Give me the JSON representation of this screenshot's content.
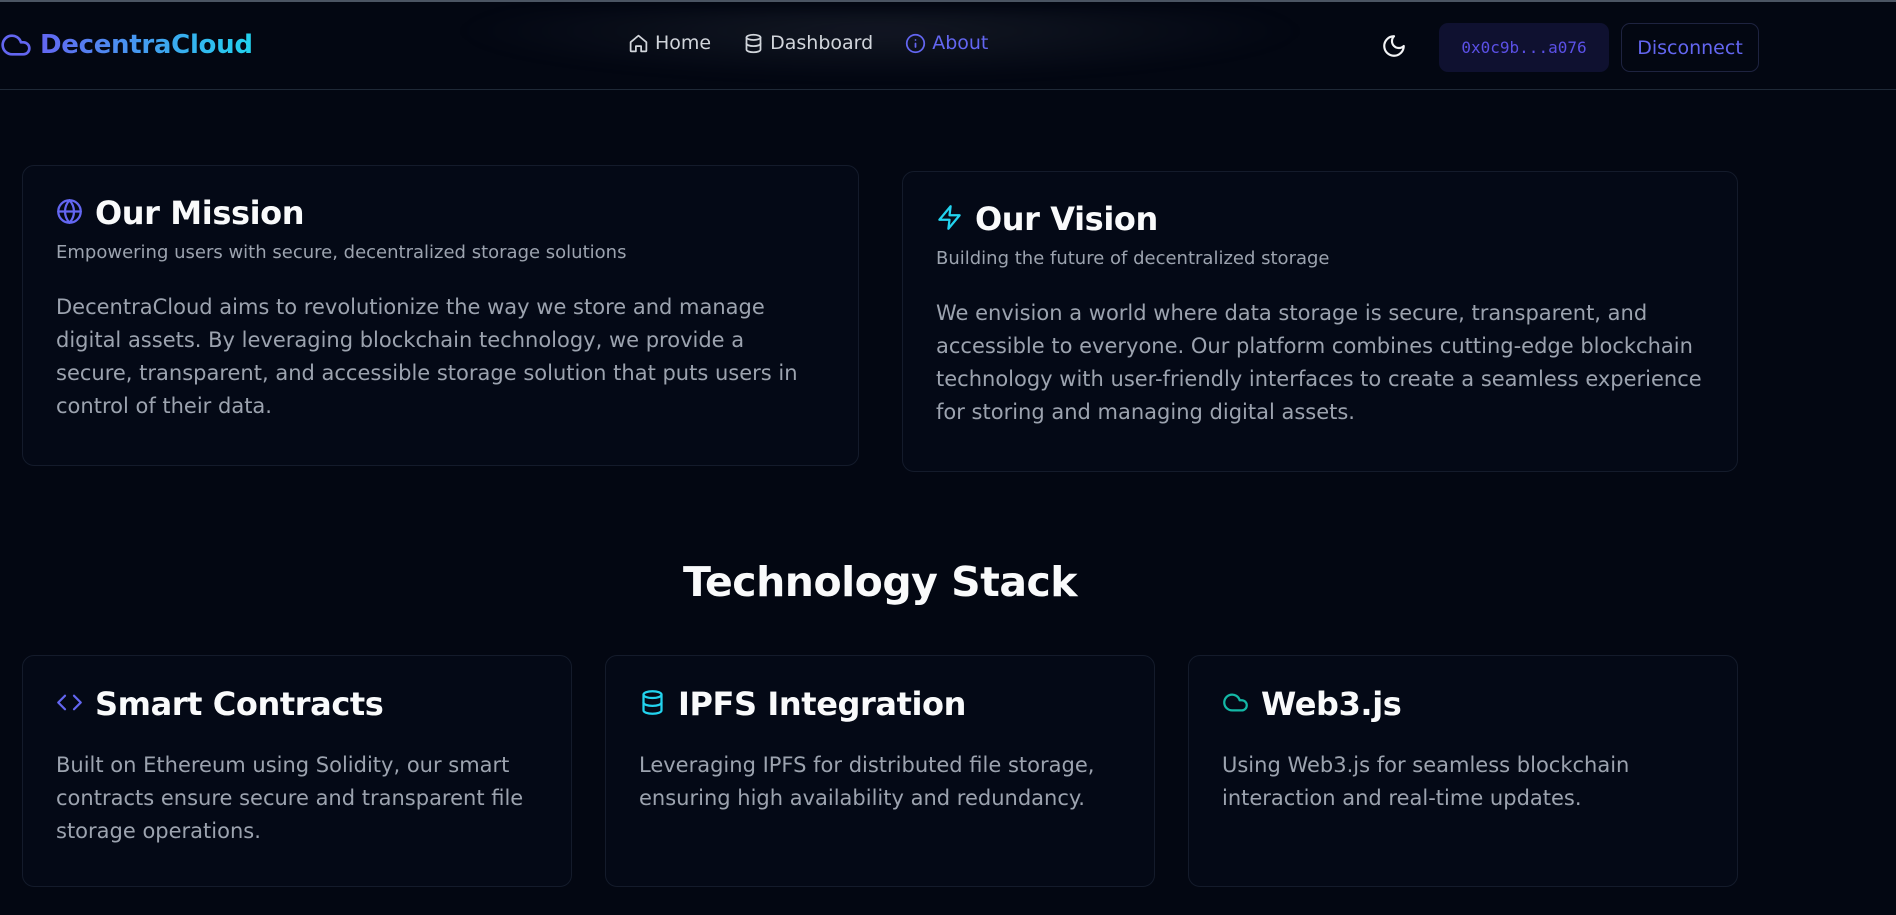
{
  "app": {
    "brand": "DecentraCloud",
    "colors": {
      "background": "#030712",
      "accent": "#6366f1",
      "accent_secondary": "#22d3ee",
      "teal": "#14b8a6"
    }
  },
  "nav": {
    "links": [
      {
        "label": "Home",
        "icon": "home-icon",
        "active": false
      },
      {
        "label": "Dashboard",
        "icon": "database-icon",
        "active": false
      },
      {
        "label": "About",
        "icon": "info-icon",
        "active": true
      }
    ],
    "theme_icon": "moon-icon",
    "wallet_address": "0x0c9b...a076",
    "disconnect_label": "Disconnect"
  },
  "mission": {
    "icon": "globe-icon",
    "title": "Our Mission",
    "subtitle": "Empowering users with secure, decentralized storage solutions",
    "body": "DecentraCloud aims to revolutionize the way we store and manage digital assets. By leveraging blockchain technology, we provide a secure, transparent, and accessible storage solution that puts users in control of their data."
  },
  "vision": {
    "icon": "lightning-icon",
    "title": "Our Vision",
    "subtitle": "Building the future of decentralized storage",
    "body": "We envision a world where data storage is secure, transparent, and accessible to everyone. Our platform combines cutting-edge blockchain technology with user-friendly interfaces to create a seamless experience for storing and managing digital assets."
  },
  "tech_stack": {
    "title": "Technology Stack",
    "items": [
      {
        "icon": "code-icon",
        "title": "Smart Contracts",
        "body": "Built on Ethereum using Solidity, our smart contracts ensure secure and transparent file storage operations."
      },
      {
        "icon": "database-icon",
        "title": "IPFS Integration",
        "body": "Leveraging IPFS for distributed file storage, ensuring high availability and redundancy."
      },
      {
        "icon": "cloud-icon",
        "title": "Web3.js",
        "body": "Using Web3.js for seamless blockchain interaction and real-time updates."
      }
    ]
  }
}
